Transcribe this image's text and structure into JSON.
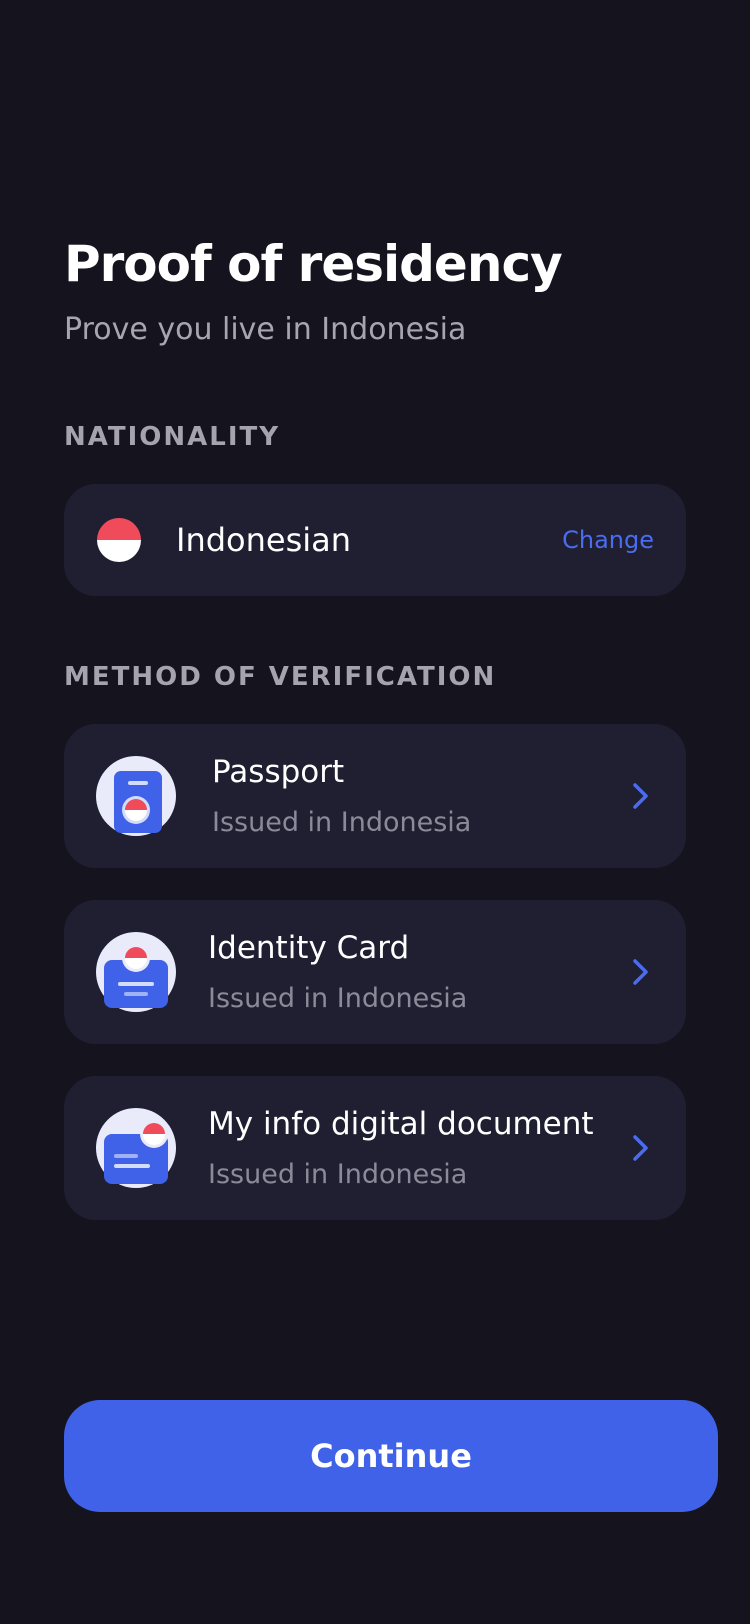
{
  "header": {
    "title": "Proof of residency",
    "subtitle": "Prove you live in Indonesia"
  },
  "nationality": {
    "section_label": "NATIONALITY",
    "value": "Indonesian",
    "flag_icon": "indonesia-flag-icon",
    "change_label": "Change"
  },
  "methods": {
    "section_label": "METHOD OF VERIFICATION",
    "items": [
      {
        "label": "Passport",
        "sublabel": "Issued in Indonesia",
        "icon": "passport-icon"
      },
      {
        "label": "Identity Card",
        "sublabel": "Issued in Indonesia",
        "icon": "id-card-icon"
      },
      {
        "label": "My info digital document",
        "sublabel": "Issued in Indonesia",
        "icon": "digital-document-icon"
      }
    ]
  },
  "footer": {
    "continue_label": "Continue"
  },
  "colors": {
    "background": "#15141e",
    "card": "#201f32",
    "accent": "#3f62e8",
    "link": "#4a6cf0",
    "flag_red": "#f04b5a"
  }
}
